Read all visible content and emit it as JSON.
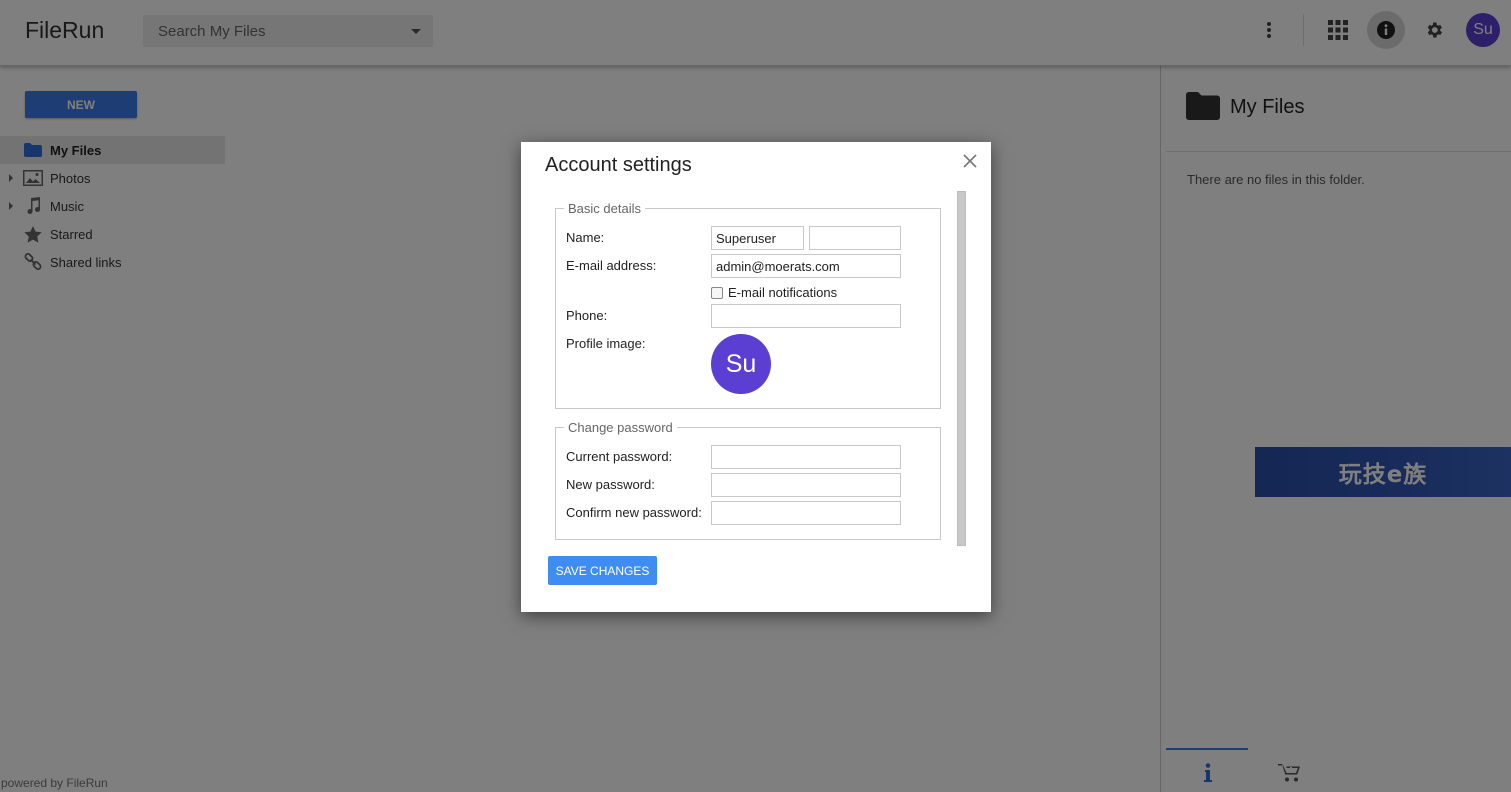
{
  "app": {
    "title": "FileRun",
    "powered_by": "powered by FileRun"
  },
  "search": {
    "placeholder": "Search My Files"
  },
  "header": {
    "user_initials": "Su",
    "icons": [
      "more-vert-icon",
      "apps-grid-icon",
      "info-icon",
      "gear-icon"
    ]
  },
  "sidebar": {
    "new_label": "NEW",
    "items": [
      {
        "label": "My Files",
        "icon": "folder-icon",
        "active": true,
        "expandable": false
      },
      {
        "label": "Photos",
        "icon": "photos-icon",
        "active": false,
        "expandable": true
      },
      {
        "label": "Music",
        "icon": "music-icon",
        "active": false,
        "expandable": true
      },
      {
        "label": "Starred",
        "icon": "star-icon",
        "active": false,
        "expandable": false
      },
      {
        "label": "Shared links",
        "icon": "link-icon",
        "active": false,
        "expandable": false
      }
    ]
  },
  "details_panel": {
    "title": "My Files",
    "empty_message": "There are no files in this folder.",
    "banner_text": "玩技e族",
    "tabs": [
      "info-tab-icon",
      "cart-tab-icon"
    ]
  },
  "dialog": {
    "title": "Account settings",
    "basic": {
      "legend": "Basic details",
      "name_label": "Name:",
      "first_name": "Superuser",
      "last_name": "",
      "email_label": "E-mail address:",
      "email": "admin@moerats.com",
      "notifications_label": "E-mail notifications",
      "notifications_checked": false,
      "phone_label": "Phone:",
      "phone": "",
      "profile_label": "Profile image:",
      "profile_initials": "Su"
    },
    "password": {
      "legend": "Change password",
      "current_label": "Current password:",
      "new_label": "New password:",
      "confirm_label": "Confirm new password:"
    },
    "save_label": "SAVE CHANGES"
  },
  "colors": {
    "accent": "#3a7be8",
    "avatar": "#5a3fd2",
    "save_button": "#3f8cf2"
  }
}
